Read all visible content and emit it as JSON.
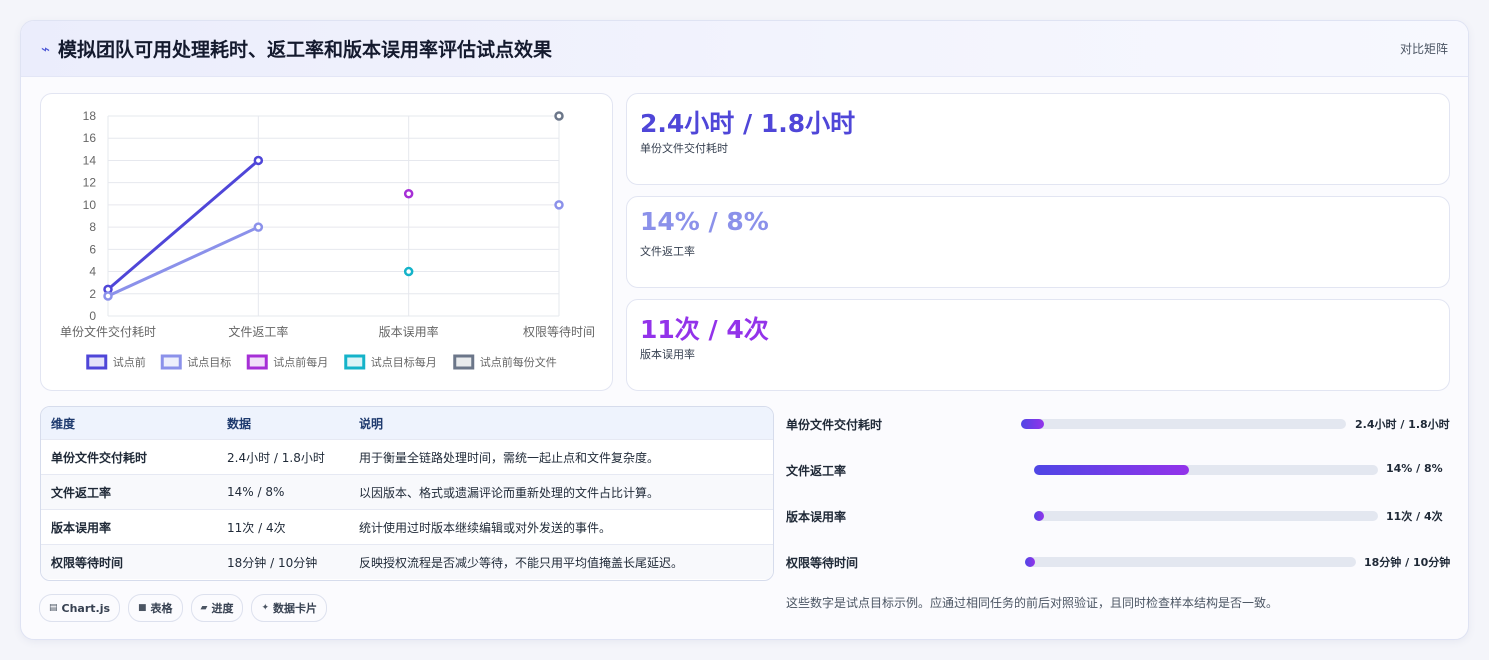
{
  "header": {
    "icon": "chart-line-icon",
    "title": "模拟团队可用处理耗时、返工率和版本误用率评估试点效果",
    "link_label": "对比矩阵"
  },
  "chart_data": {
    "type": "line",
    "categories": [
      "单份文件交付耗时",
      "文件返工率",
      "版本误用率",
      "权限等待时间"
    ],
    "ylim": [
      0,
      18
    ],
    "yticks": [
      0,
      2,
      4,
      6,
      8,
      10,
      12,
      14,
      16,
      18
    ],
    "grid": true,
    "legend_position": "bottom",
    "series": [
      {
        "name": "试点前",
        "color": "#4f46d8",
        "values": [
          2.4,
          14,
          null,
          null
        ]
      },
      {
        "name": "试点目标",
        "color": "#8b91ea",
        "values": [
          1.8,
          8,
          null,
          10
        ]
      },
      {
        "name": "试点前每月",
        "color": "#a62fd6",
        "values": [
          null,
          null,
          11,
          null
        ]
      },
      {
        "name": "试点目标每月",
        "color": "#14b3c9",
        "values": [
          null,
          null,
          4,
          null
        ]
      },
      {
        "name": "试点前每份文件",
        "color": "#6b7689",
        "values": [
          null,
          null,
          null,
          18
        ]
      }
    ]
  },
  "kpis": [
    {
      "value": "2.4小时 / 1.8小时",
      "label": "单份文件交付耗时",
      "color": "#4f46d8"
    },
    {
      "value": "14% / 8%",
      "label": "文件返工率",
      "color": "#8b91ea"
    },
    {
      "value": "11次 / 4次",
      "label": "版本误用率",
      "color": "#9333ea"
    }
  ],
  "table": {
    "headers": [
      "维度",
      "数据",
      "说明"
    ],
    "rows": [
      [
        "单份文件交付耗时",
        "2.4小时 / 1.8小时",
        "用于衡量全链路处理时间，需统一起止点和文件复杂度。"
      ],
      [
        "文件返工率",
        "14% / 8%",
        "以因版本、格式或遗漏评论而重新处理的文件占比计算。"
      ],
      [
        "版本误用率",
        "11次 / 4次",
        "统计使用过时版本继续编辑或对外发送的事件。"
      ],
      [
        "权限等待时间",
        "18分钟 / 10分钟",
        "反映授权流程是否减少等待，不能只用平均值掩盖长尾延迟。"
      ]
    ]
  },
  "chips": [
    {
      "icon": "chart-icon",
      "label": "Chart.js"
    },
    {
      "icon": "table-icon",
      "label": "表格"
    },
    {
      "icon": "progress-icon",
      "label": "进度"
    },
    {
      "icon": "sparkle-icon",
      "label": "数据卡片"
    }
  ],
  "progress": [
    {
      "label": "单份文件交付耗时",
      "value": "2.4小时 / 1.8小时",
      "fill_fraction": 0.07
    },
    {
      "label": "文件返工率",
      "value": "14% / 8%",
      "fill_fraction": 0.45
    },
    {
      "label": "版本误用率",
      "value": "11次 / 4次",
      "fill_fraction": 0.03
    },
    {
      "label": "权限等待时间",
      "value": "18分钟 / 10分钟",
      "fill_fraction": 0.03
    }
  ],
  "note": "这些数字是试点目标示例。应通过相同任务的前后对照验证，且同时检查样本结构是否一致。"
}
